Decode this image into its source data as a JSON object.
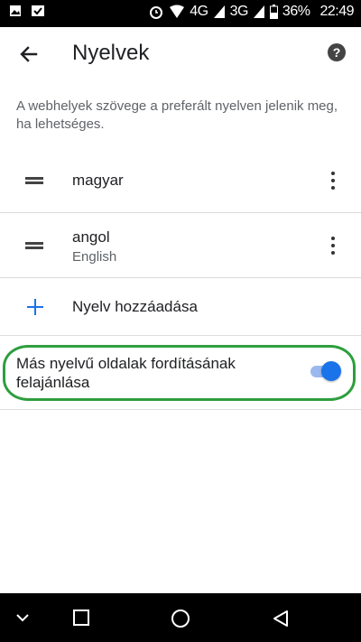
{
  "status_bar": {
    "network_4g": "4G",
    "network_3g": "3G",
    "battery": "36%",
    "time": "22:49",
    "icons": [
      "image-icon",
      "download-icon",
      "alarm-icon",
      "wifi-icon",
      "signal-icon",
      "signal-icon",
      "battery-icon"
    ]
  },
  "toolbar": {
    "title": "Nyelvek",
    "back_icon": "arrow-left-icon",
    "help_icon": "help-icon",
    "help_glyph": "?"
  },
  "description": "A webhelyek szövege a preferált nyelven jelenik meg, ha lehetséges.",
  "languages": [
    {
      "label": "magyar",
      "sub": ""
    },
    {
      "label": "angol",
      "sub": "English"
    }
  ],
  "add_language_label": "Nyelv hozzáadása",
  "translate_offer": {
    "label": "Más nyelvű oldalak fordításának felajánlása",
    "enabled": true
  },
  "colors": {
    "accent": "#1a73e8",
    "highlight": "#2e9e3e"
  },
  "navbar": {
    "icons": [
      "chevron-down-icon",
      "overview-square-icon",
      "home-circle-icon",
      "back-triangle-icon"
    ]
  }
}
